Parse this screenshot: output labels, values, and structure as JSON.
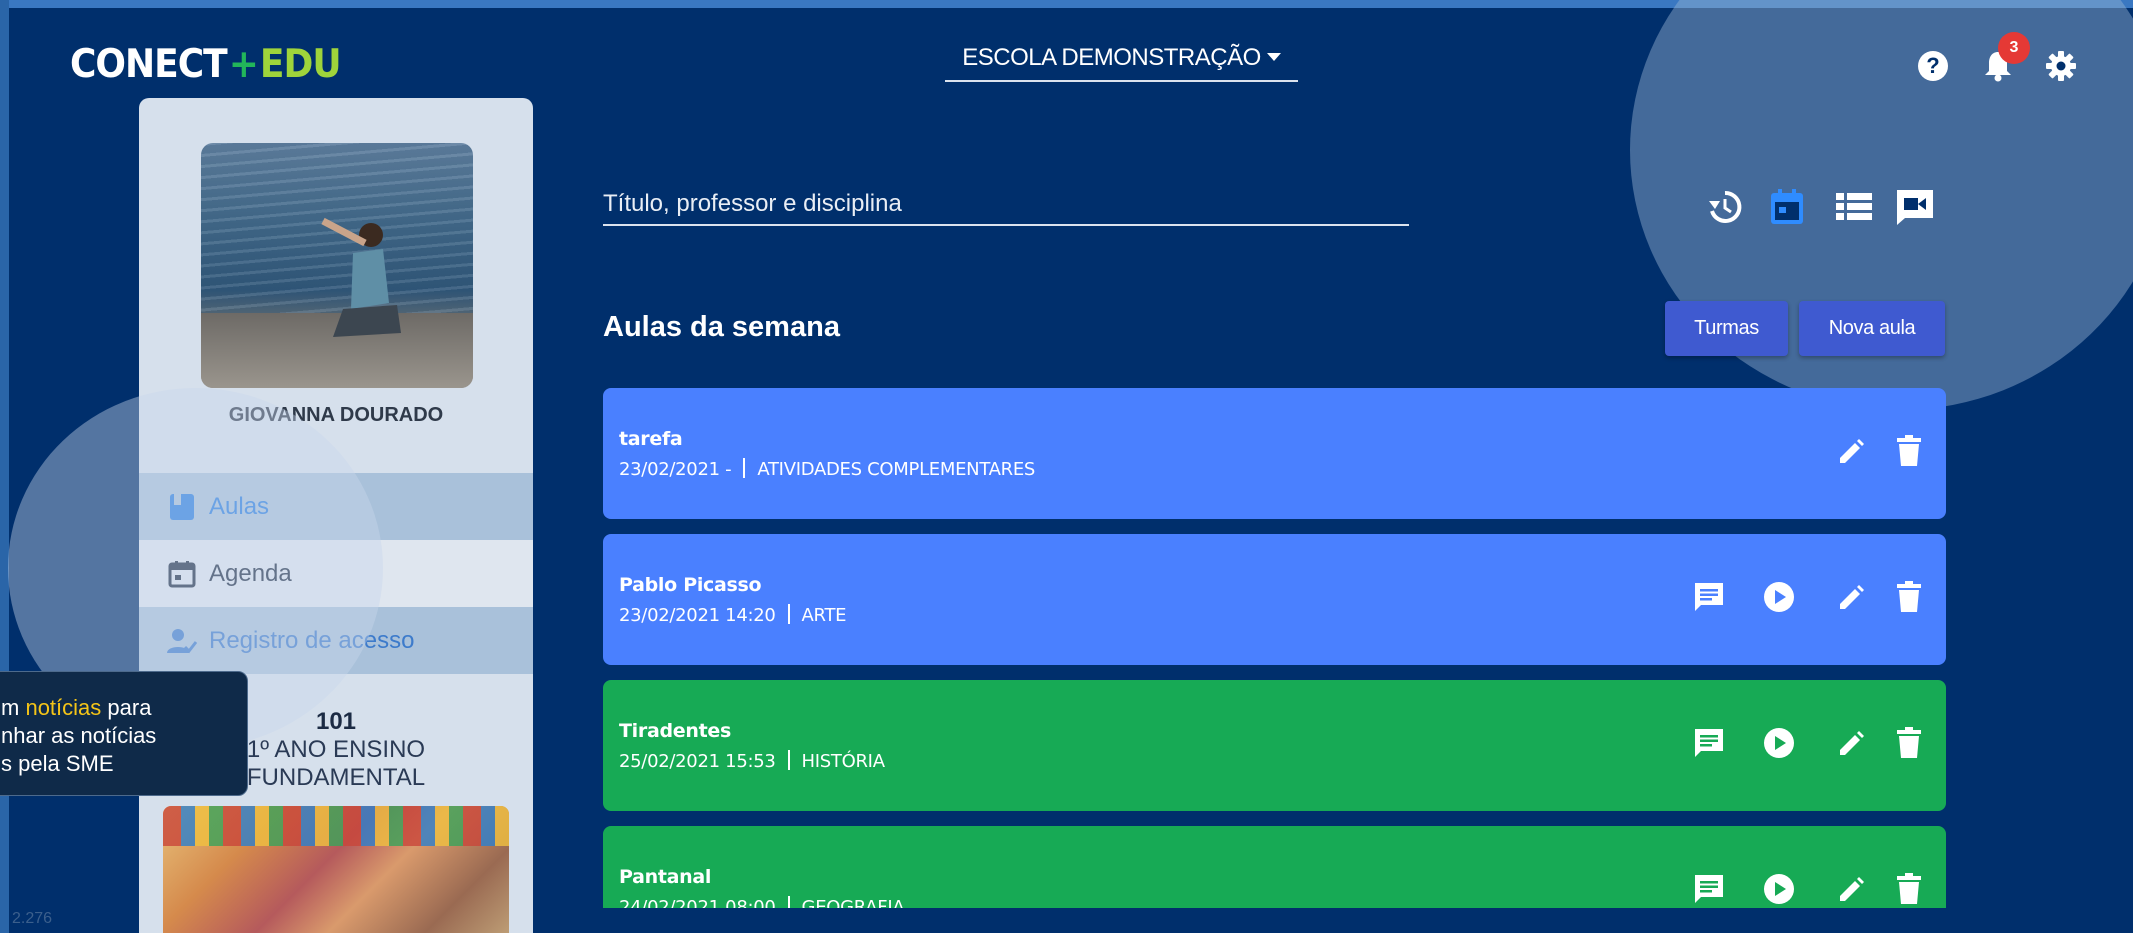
{
  "app": {
    "logo": {
      "part1": "CONECT",
      "plus": "+",
      "part2": "EDU"
    },
    "school_selector": {
      "label": "ESCOLA DEMONSTRAÇÃO"
    },
    "notifications": {
      "count": "3"
    },
    "icons": [
      "help-icon",
      "bell-icon",
      "gear-icon"
    ]
  },
  "sidebar": {
    "user_name": "GIOVANNA DOURADO",
    "menu": [
      {
        "label": "Aulas",
        "icon": "book-icon",
        "active": true
      },
      {
        "label": "Agenda",
        "icon": "calendar-icon"
      },
      {
        "label": "Registro de acesso",
        "icon": "user-check-icon"
      }
    ],
    "class": {
      "number": "101",
      "description_line1": "1º ANO ENSINO",
      "description_line2": "FUNDAMENTAL"
    }
  },
  "tooltip": {
    "prefix": "m ",
    "highlight": "notícias",
    "line1_suffix": " para",
    "line2": "nhar as notícias",
    "line3": "s pela SME"
  },
  "version": "2.276",
  "main": {
    "search": {
      "placeholder": "Título, professor e disciplina"
    },
    "view_icons": [
      "history-icon",
      "calendar-view-icon",
      "list-view-icon",
      "video-icon"
    ],
    "section_title": "Aulas da semana",
    "buttons": {
      "turmas": "Turmas",
      "nova_aula": "Nova aula"
    },
    "lessons": [
      {
        "title": "tarefa",
        "datetime": "23/02/2021 -",
        "subject": "ATIVIDADES COMPLEMENTARES",
        "color": "#4a80ff",
        "actions": [
          "edit",
          "delete"
        ]
      },
      {
        "title": "Pablo Picasso",
        "datetime": "23/02/2021 14:20",
        "subject": "ARTE",
        "color": "#4a80ff",
        "actions": [
          "chat",
          "play",
          "edit",
          "delete"
        ]
      },
      {
        "title": "Tiradentes",
        "datetime": "25/02/2021 15:53",
        "subject": "HISTÓRIA",
        "color": "#17aa55",
        "actions": [
          "chat",
          "play",
          "edit",
          "delete"
        ]
      },
      {
        "title": "Pantanal",
        "datetime": "24/02/2021 08:00",
        "subject": "GEOGRAFIA",
        "color": "#17aa55",
        "actions": [
          "chat",
          "play",
          "edit",
          "delete"
        ]
      }
    ]
  },
  "colors": {
    "background": "#002f6c",
    "card_blue": "#4a80ff",
    "card_green": "#17aa55",
    "button": "#3f5ad0",
    "badge": "#e53935"
  }
}
